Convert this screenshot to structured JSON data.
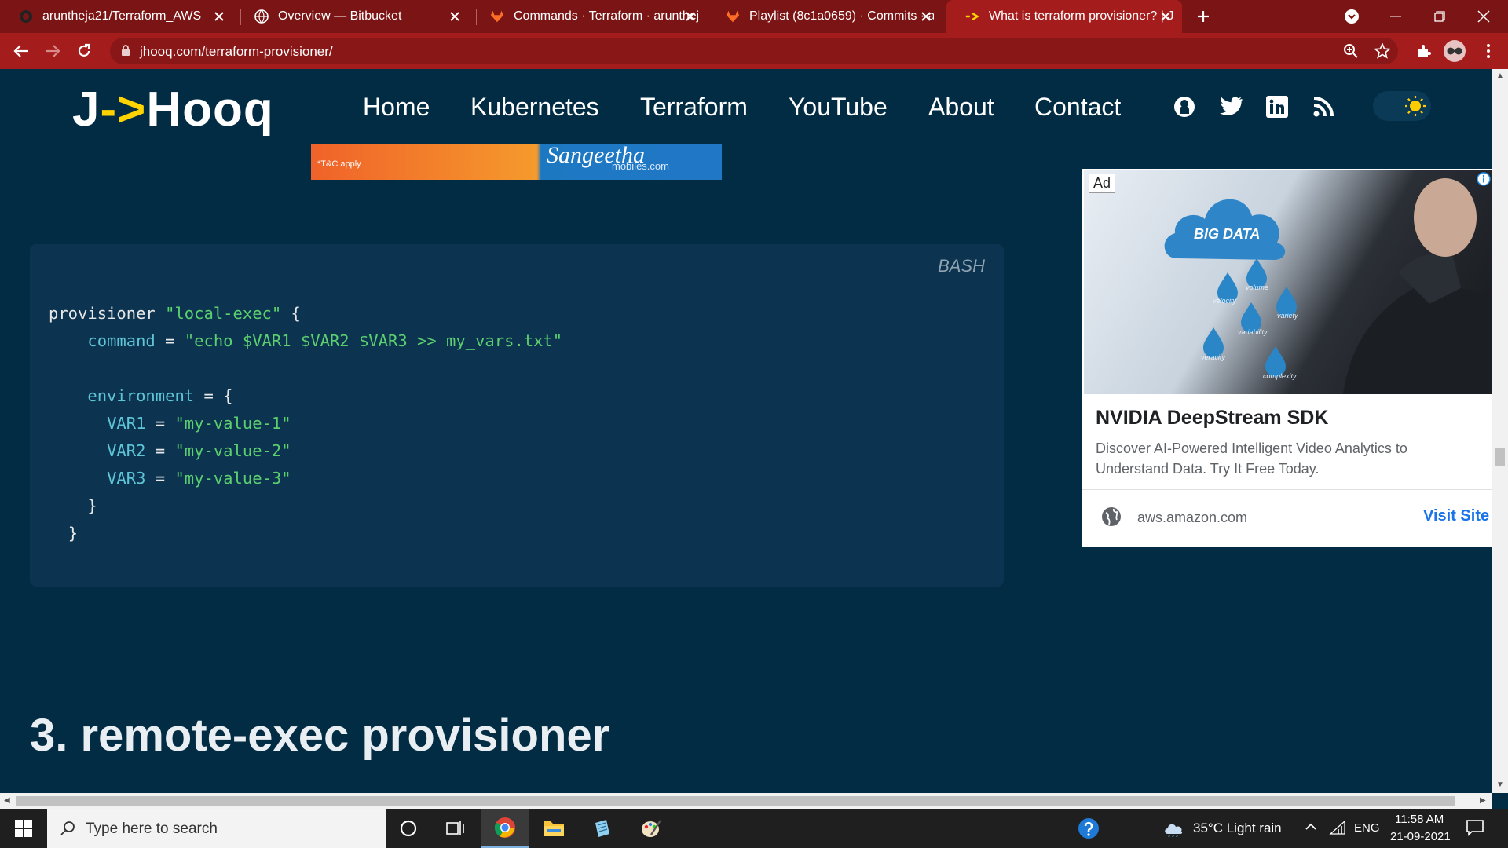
{
  "browser": {
    "tabs": [
      {
        "title": "aruntheja21/Terraform_AWS",
        "favicon": "github-icon"
      },
      {
        "title": "Overview — Bitbucket",
        "favicon": "globe-icon"
      },
      {
        "title": "Commands · Terraform · arunthej",
        "favicon": "gitlab-icon"
      },
      {
        "title": "Playlist (8c1a0659) · Commits · ar",
        "favicon": "gitlab-icon"
      },
      {
        "title": "What is terraform provisioner? | J",
        "favicon": "jhooq-icon"
      }
    ],
    "url": "jhooq.com/terraform-provisioner/",
    "colors": {
      "tab_strip": "#7b1414",
      "toolbar": "#a51c1c"
    }
  },
  "site": {
    "logo_left": "J",
    "logo_arrow": "->",
    "logo_right": "Hooq",
    "nav": [
      "Home",
      "Kubernetes",
      "Terraform",
      "YouTube",
      "About",
      "Contact"
    ],
    "social": [
      "github-icon",
      "twitter-icon",
      "linkedin-icon",
      "rss-icon"
    ]
  },
  "banner": {
    "tc": "*T&C apply",
    "brand": "Sangeetha",
    "brand_sub": "mobiles.com"
  },
  "code": {
    "lang": "BASH",
    "l1_kw": "provisioner",
    "l1_str": "\"local-exec\"",
    "l1_brace": " {",
    "l2_attr": "command",
    "l2_eq": " = ",
    "l2_str": "\"echo $VAR1 $VAR2 $VAR3 >> my_vars.txt\"",
    "l3_attr": "environment",
    "l3_rest": " = {",
    "v1_attr": "VAR1",
    "v1_str": "\"my-value-1\"",
    "v2_attr": "VAR2",
    "v2_str": "\"my-value-2\"",
    "v3_attr": "VAR3",
    "v3_str": "\"my-value-3\"",
    "eq": " = ",
    "close_inner": "}",
    "close_outer": "}"
  },
  "section_heading": "3. remote-exec provisioner",
  "ad": {
    "badge": "Ad",
    "image_caption": "BIG DATA",
    "drops": [
      "velocity",
      "volume",
      "variety",
      "variability",
      "veracity",
      "complexity"
    ],
    "title": "NVIDIA DeepStream SDK",
    "description": "Discover AI-Powered Intelligent Video Analytics to Understand Data. Try It Free Today.",
    "domain": "aws.amazon.com",
    "cta": "Visit Site"
  },
  "taskbar": {
    "search_placeholder": "Type here to search",
    "weather": "35°C  Light rain",
    "lang": "ENG",
    "time": "11:58 AM",
    "date": "21-09-2021"
  }
}
